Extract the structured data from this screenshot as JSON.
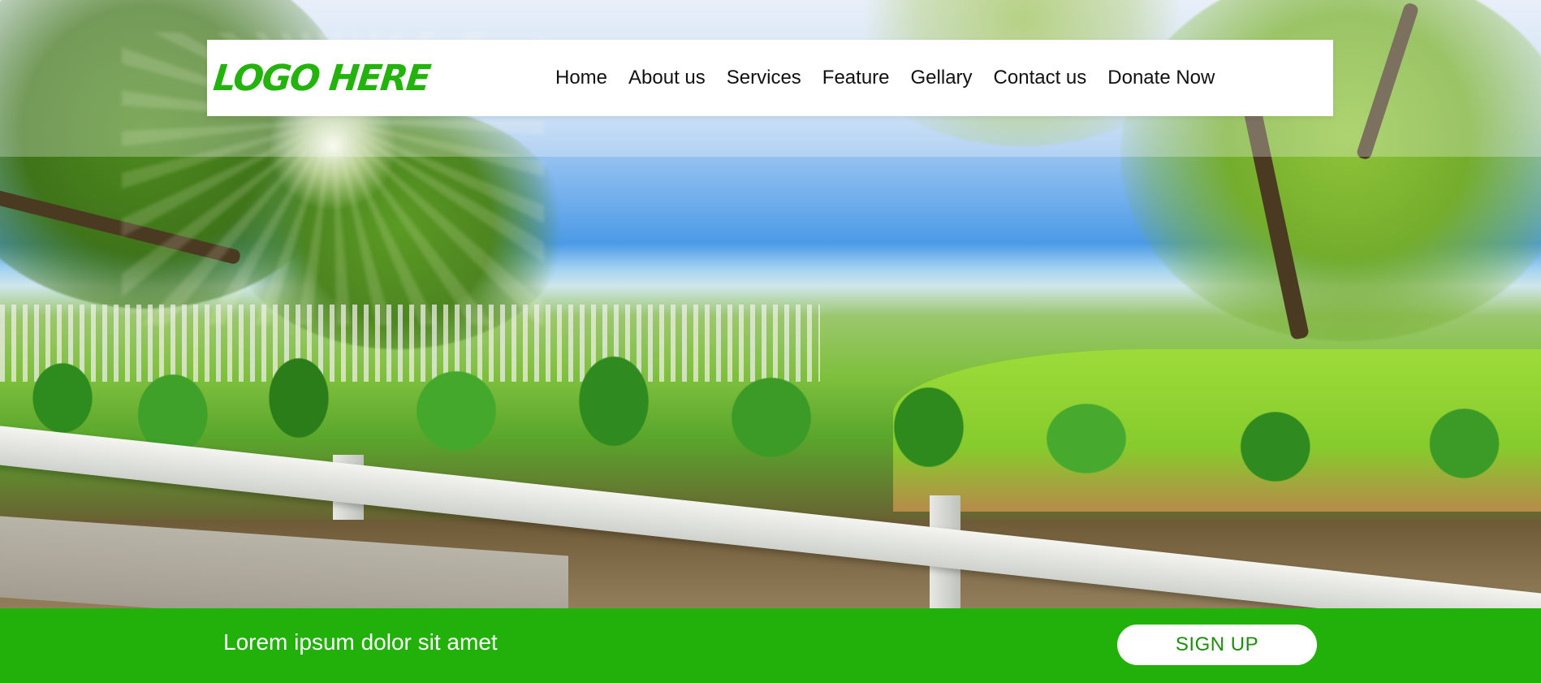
{
  "header": {
    "logo_text": "LOGO HERE",
    "nav": [
      {
        "label": "Home"
      },
      {
        "label": "About us"
      },
      {
        "label": "Services"
      },
      {
        "label": "Feature"
      },
      {
        "label": "Gellary"
      },
      {
        "label": "Contact us"
      },
      {
        "label": "Donate Now"
      }
    ]
  },
  "hero": {
    "image": "garden-fence-landscape"
  },
  "bottom_bar": {
    "text": "Lorem ipsum dolor sit amet",
    "button_label": "SIGN UP"
  },
  "colors": {
    "brand_green": "#22b00b",
    "logo_green": "#24b30d",
    "nav_background": "#ffffff",
    "button_text": "#1c8f0a"
  }
}
